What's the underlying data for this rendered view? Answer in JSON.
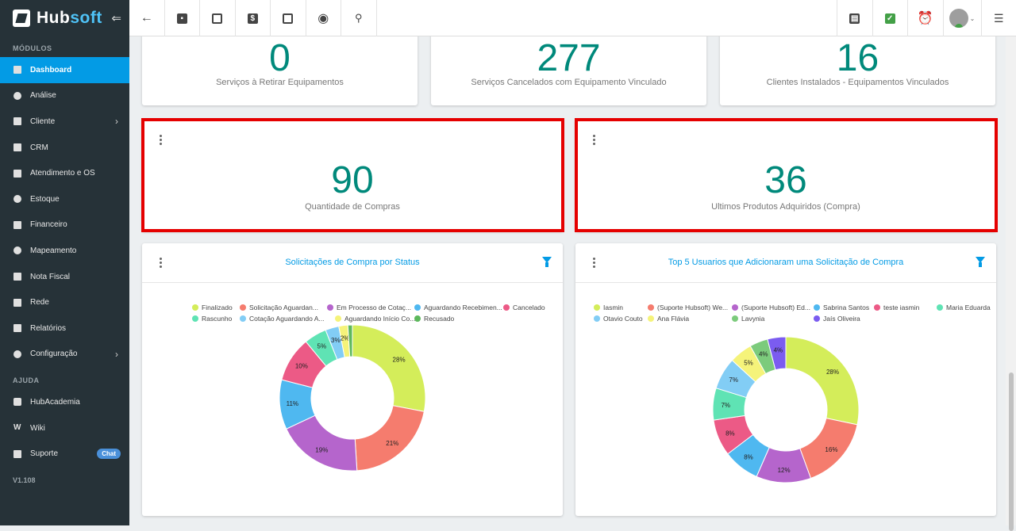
{
  "sidebar": {
    "brand_main": "Hub",
    "brand_soft": "soft",
    "collapse_icon": "⇐",
    "modules_label": "MÓDULOS",
    "items": [
      {
        "label": "Dashboard",
        "icon": "dashboard-icon"
      },
      {
        "label": "Análise",
        "icon": "chart-icon"
      },
      {
        "label": "Cliente",
        "icon": "contact-icon"
      },
      {
        "label": "CRM",
        "icon": "crm-icon"
      },
      {
        "label": "Atendimento e OS",
        "icon": "calendar-clock-icon"
      },
      {
        "label": "Estoque",
        "icon": "box-icon"
      },
      {
        "label": "Financeiro",
        "icon": "money-icon"
      },
      {
        "label": "Mapeamento",
        "icon": "map-pin-icon"
      },
      {
        "label": "Nota Fiscal",
        "icon": "invoice-icon"
      },
      {
        "label": "Rede",
        "icon": "network-icon"
      },
      {
        "label": "Relatórios",
        "icon": "report-icon"
      },
      {
        "label": "Configuração",
        "icon": "gear-icon"
      }
    ],
    "help_label": "AJUDA",
    "help_items": [
      {
        "label": "HubAcademia",
        "icon": "youtube-icon"
      },
      {
        "label": "Wiki",
        "icon": "wikipedia-icon"
      },
      {
        "label": "Suporte",
        "icon": "message-icon",
        "badge": "Chat"
      }
    ],
    "version": "V1.108"
  },
  "topbar": {
    "icons": [
      "back-arrow-icon",
      "contact-card-icon",
      "calendar-clock-icon",
      "dollar-icon",
      "terminal-icon",
      "eye-icon",
      "search-icon"
    ],
    "right_icons": [
      "pdf-icon",
      "message-check-icon",
      "alarm-bell-icon",
      "user-avatar",
      "list-icon"
    ],
    "colors": {
      "message": "#43a047",
      "alarm": "#e53935"
    }
  },
  "stats_top": [
    {
      "value": "0",
      "label": "Serviços à Retirar Equipamentos"
    },
    {
      "value": "277",
      "label": "Serviços Cancelados com Equipamento Vinculado"
    },
    {
      "value": "16",
      "label": "Clientes Instalados - Equipamentos Vinculados"
    }
  ],
  "stats_mid": [
    {
      "value": "90",
      "label": "Quantidade de Compras"
    },
    {
      "value": "36",
      "label": "Ultimos Produtos Adquiridos (Compra)"
    }
  ],
  "colors": {
    "accent": "#039be5",
    "stat": "#00897b",
    "highlight": "#e50000",
    "sidebar": "#263238"
  },
  "chart_data": [
    {
      "type": "pie",
      "title": "Solicitações de Compra por Status",
      "categories": [
        "Finalizado",
        "Solicitação Aguardan...",
        "Em Processo de Cotaç...",
        "Aguardando Recebimen...",
        "Cancelado",
        "Rascunho",
        "Cotação Aguardando A...",
        "Aguardando Início Co...",
        "Recusado"
      ],
      "values": [
        28,
        21,
        19,
        11,
        10,
        5,
        3,
        2,
        1
      ],
      "labels": [
        "28%",
        "21%",
        "19%",
        "11%",
        "10%",
        "5%",
        "3%",
        "2%",
        ""
      ],
      "colors": [
        "#d4ed5a",
        "#f57c6e",
        "#b565cc",
        "#4fb8f0",
        "#ec5a86",
        "#5fe3b4",
        "#82cdf5",
        "#f5f37a",
        "#5cb85c"
      ],
      "legend": "top"
    },
    {
      "type": "pie",
      "title": "Top 5 Usuarios que Adicionaram uma Solicitação de Compra",
      "categories": [
        "Iasmin",
        "(Suporte Hubsoft) We...",
        "(Suporte Hubsoft) Ed...",
        "Sabrina Santos",
        "teste iasmin",
        "Maria Eduarda",
        "Otavio Couto",
        "Ana Flávia",
        "Lavynia",
        "Jaís Oliveira"
      ],
      "values": [
        28,
        16,
        12,
        8,
        8,
        7,
        7,
        5,
        4,
        4
      ],
      "labels": [
        "28%",
        "16%",
        "12%",
        "8%",
        "8%",
        "7%",
        "7%",
        "5%",
        "4%",
        "4%"
      ],
      "colors": [
        "#d4ed5a",
        "#f57c6e",
        "#b565cc",
        "#4fb8f0",
        "#ec5a86",
        "#5fe3b4",
        "#82cdf5",
        "#f5f37a",
        "#7ccb7c",
        "#7b5cf0"
      ],
      "legend": "top"
    }
  ]
}
